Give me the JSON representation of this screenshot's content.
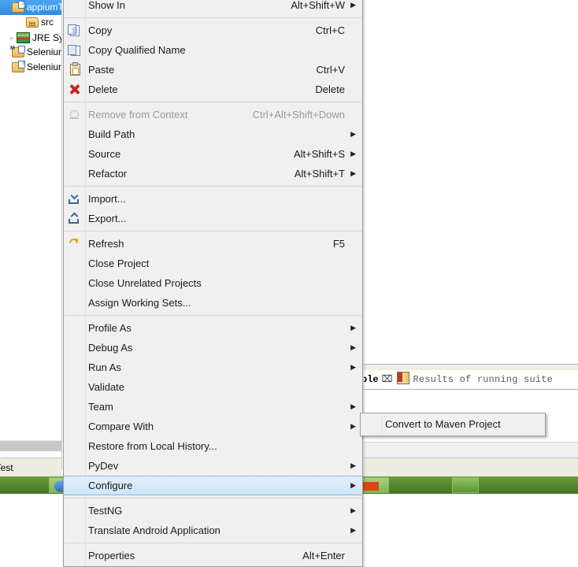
{
  "explorer": {
    "items": [
      {
        "label": "appiumTe",
        "icon": "java-project-icon",
        "selected": true,
        "indent": 0,
        "twisty": ""
      },
      {
        "label": "src",
        "icon": "source-folder-icon",
        "selected": false,
        "indent": 18,
        "twisty": ""
      },
      {
        "label": "JRE Sy",
        "icon": "jre-library-icon",
        "selected": false,
        "indent": 6,
        "twisty": "▹"
      },
      {
        "label": "SeleniumM",
        "icon": "maven-project-icon",
        "selected": false,
        "indent": 0,
        "twisty": ""
      },
      {
        "label": "SeleniumT",
        "icon": "java-project-icon",
        "selected": false,
        "indent": 0,
        "twisty": ""
      }
    ],
    "bottom_tab_label": "umTest"
  },
  "right_panel": {
    "tab_console_label": "ble",
    "tab_close_glyph": "⌧",
    "tab_results_label": "Results of running suite",
    "tab_results_icon": "testng-icon"
  },
  "context_menu": {
    "items": [
      {
        "type": "item",
        "label": "Show In",
        "accel": "Alt+Shift+W",
        "arrow": true,
        "icon": "",
        "disabled": false,
        "selected": false,
        "clipped": true
      },
      {
        "type": "separator"
      },
      {
        "type": "item",
        "label": "Copy",
        "accel": "Ctrl+C",
        "arrow": false,
        "icon": "copy-icon",
        "disabled": false,
        "selected": false
      },
      {
        "type": "item",
        "label": "Copy Qualified Name",
        "accel": "",
        "arrow": false,
        "icon": "copy-qualified-name-icon",
        "disabled": false,
        "selected": false
      },
      {
        "type": "item",
        "label": "Paste",
        "accel": "Ctrl+V",
        "arrow": false,
        "icon": "paste-icon",
        "disabled": false,
        "selected": false
      },
      {
        "type": "item",
        "label": "Delete",
        "accel": "Delete",
        "arrow": false,
        "icon": "delete-icon",
        "disabled": false,
        "selected": false
      },
      {
        "type": "separator"
      },
      {
        "type": "item",
        "label": "Remove from Context",
        "accel": "Ctrl+Alt+Shift+Down",
        "arrow": false,
        "icon": "remove-from-context-icon",
        "disabled": true,
        "selected": false
      },
      {
        "type": "item",
        "label": "Build Path",
        "accel": "",
        "arrow": true,
        "icon": "",
        "disabled": false,
        "selected": false
      },
      {
        "type": "item",
        "label": "Source",
        "accel": "Alt+Shift+S",
        "arrow": true,
        "icon": "",
        "disabled": false,
        "selected": false
      },
      {
        "type": "item",
        "label": "Refactor",
        "accel": "Alt+Shift+T",
        "arrow": true,
        "icon": "",
        "disabled": false,
        "selected": false
      },
      {
        "type": "separator"
      },
      {
        "type": "item",
        "label": "Import...",
        "accel": "",
        "arrow": false,
        "icon": "import-icon",
        "disabled": false,
        "selected": false
      },
      {
        "type": "item",
        "label": "Export...",
        "accel": "",
        "arrow": false,
        "icon": "export-icon",
        "disabled": false,
        "selected": false
      },
      {
        "type": "separator"
      },
      {
        "type": "item",
        "label": "Refresh",
        "accel": "F5",
        "arrow": false,
        "icon": "refresh-icon",
        "disabled": false,
        "selected": false
      },
      {
        "type": "item",
        "label": "Close Project",
        "accel": "",
        "arrow": false,
        "icon": "",
        "disabled": false,
        "selected": false
      },
      {
        "type": "item",
        "label": "Close Unrelated Projects",
        "accel": "",
        "arrow": false,
        "icon": "",
        "disabled": false,
        "selected": false
      },
      {
        "type": "item",
        "label": "Assign Working Sets...",
        "accel": "",
        "arrow": false,
        "icon": "",
        "disabled": false,
        "selected": false
      },
      {
        "type": "separator"
      },
      {
        "type": "item",
        "label": "Profile As",
        "accel": "",
        "arrow": true,
        "icon": "",
        "disabled": false,
        "selected": false
      },
      {
        "type": "item",
        "label": "Debug As",
        "accel": "",
        "arrow": true,
        "icon": "",
        "disabled": false,
        "selected": false
      },
      {
        "type": "item",
        "label": "Run As",
        "accel": "",
        "arrow": true,
        "icon": "",
        "disabled": false,
        "selected": false
      },
      {
        "type": "item",
        "label": "Validate",
        "accel": "",
        "arrow": false,
        "icon": "",
        "disabled": false,
        "selected": false
      },
      {
        "type": "item",
        "label": "Team",
        "accel": "",
        "arrow": true,
        "icon": "",
        "disabled": false,
        "selected": false
      },
      {
        "type": "item",
        "label": "Compare With",
        "accel": "",
        "arrow": true,
        "icon": "",
        "disabled": false,
        "selected": false
      },
      {
        "type": "item",
        "label": "Restore from Local History...",
        "accel": "",
        "arrow": false,
        "icon": "",
        "disabled": false,
        "selected": false
      },
      {
        "type": "item",
        "label": "PyDev",
        "accel": "",
        "arrow": true,
        "icon": "",
        "disabled": false,
        "selected": false
      },
      {
        "type": "item",
        "label": "Configure",
        "accel": "",
        "arrow": true,
        "icon": "",
        "disabled": false,
        "selected": true
      },
      {
        "type": "separator"
      },
      {
        "type": "item",
        "label": "TestNG",
        "accel": "",
        "arrow": true,
        "icon": "",
        "disabled": false,
        "selected": false
      },
      {
        "type": "item",
        "label": "Translate Android Application",
        "accel": "",
        "arrow": true,
        "icon": "",
        "disabled": false,
        "selected": false
      },
      {
        "type": "separator"
      },
      {
        "type": "item",
        "label": "Properties",
        "accel": "Alt+Enter",
        "arrow": false,
        "icon": "",
        "disabled": false,
        "selected": false
      }
    ]
  },
  "submenu": {
    "parent": "Configure",
    "items": [
      {
        "label": "Convert to Maven Project",
        "accel": "",
        "arrow": false,
        "icon": "",
        "disabled": false,
        "selected": false
      }
    ]
  },
  "taskbar": {
    "buttons": [
      "browser-icon",
      "eclipse-icon",
      "explorer-icon",
      "app-icon",
      "other-icon"
    ]
  },
  "colors": {
    "menu_bg": "#f0f0f0",
    "menu_border": "#9e9e9e",
    "highlight_bg": "#cfe5f8",
    "highlight_border": "#8ab8dd",
    "selection_blue": "#3399ff",
    "disabled_text": "#9a9a9a",
    "tab_bg": "#efece1",
    "taskbar_green": "#6a9e3e"
  }
}
